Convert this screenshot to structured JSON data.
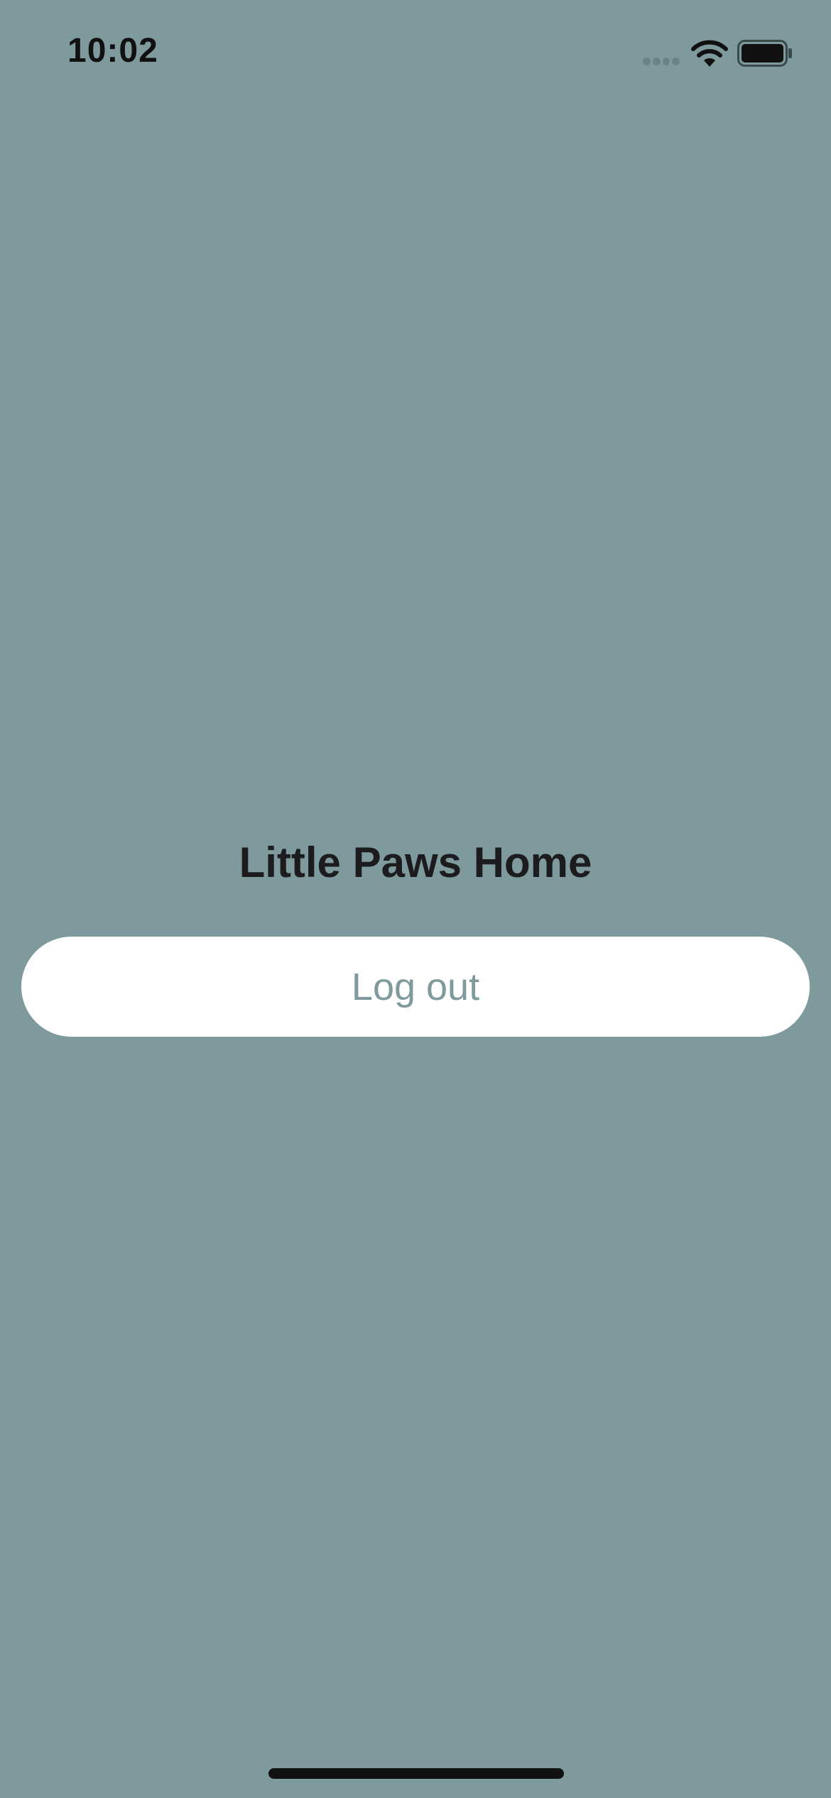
{
  "status_bar": {
    "time": "10:02",
    "icons": [
      "signal-icon",
      "wifi-icon",
      "battery-icon"
    ]
  },
  "main": {
    "title": "Little Paws Home",
    "logout_label": "Log out"
  },
  "colors": {
    "background": "#7f9a9c",
    "button_background": "#ffffff",
    "button_text": "#7f9a9c",
    "title_text": "#1c1c1e"
  }
}
